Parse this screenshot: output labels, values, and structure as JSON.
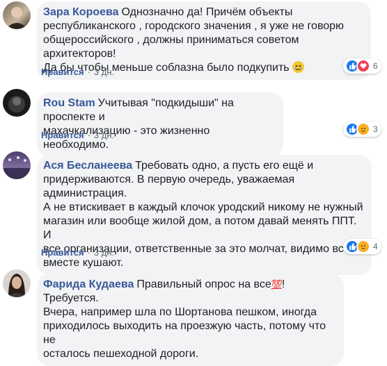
{
  "comments": [
    {
      "author": "Зара Короева",
      "text": "Однозначно да! Причём объекты\nреспубликанского , городского значения , я уже не говорю\nобщероссийского , должны приниматься советом архитекторов!\nДа бы чтобы меньше соблазна было подкупить",
      "like_label": "Нравится",
      "time": "3 дн.",
      "reaction_count": "6",
      "reactions": [
        "like-icon",
        "love-icon"
      ],
      "inline_emoji": "crying-face-icon"
    },
    {
      "author": "Rou Stam",
      "text": "Учитывая \"подкидыши\" на проспекте и\nмахачкализацию - это жизненно необходимо.",
      "like_label": "Нравится",
      "time": "3 дн.",
      "reaction_count": "3",
      "reactions": [
        "like-icon",
        "sad-icon"
      ]
    },
    {
      "author": "Ася Бесланеева",
      "text": "Требовать одно, а пусть его ещё и\nпридерживаются. В первую очередь, уважаемая администрация.\nА не втискивает в каждый клочок уродский никому не нужный\nмагазин или вообще жилой дом, а потом давай менять ППТ. И\nвсе организации, ответственные за это молчат, видимо все\nвместе кушают.",
      "like_label": "Нравится",
      "time": "3 дн.",
      "reaction_count": "4",
      "reactions": [
        "like-icon",
        "sad-icon"
      ]
    },
    {
      "author": "Фарида Кудаева",
      "text_before_emoji": "Правильный опрос на все",
      "inline_emoji_text": "💯",
      "text_after_emoji": "! Требуется.\nВчера, например шла по Шортанова пешком, иногда\nприходилось выходить на проезжую часть, потому что не\nосталось пешеходной дороги."
    }
  ],
  "colors": {
    "author": "#385898",
    "bubble": "#f2f3f5",
    "meta": "#606770",
    "like_reaction": "#1877f2",
    "love_reaction": "#f33e58",
    "sad_reaction": "#f7b125"
  }
}
